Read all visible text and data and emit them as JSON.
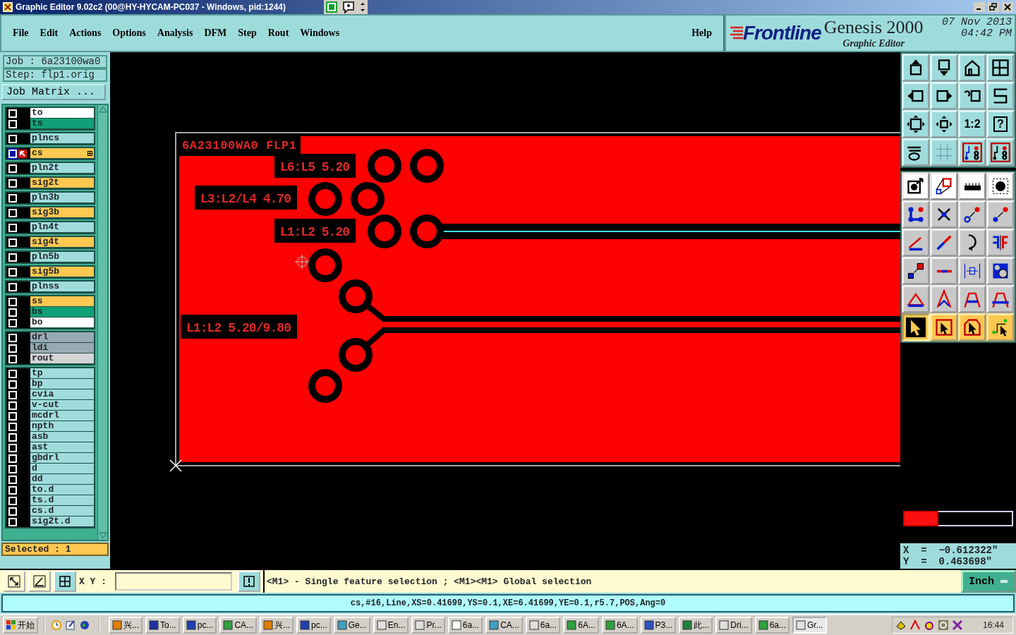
{
  "window": {
    "title": "Graphic Editor 9.02c2 (00@HY-HYCAM-PC037 - Windows, pid:1244)"
  },
  "menu": [
    {
      "label": "File"
    },
    {
      "label": "Edit"
    },
    {
      "label": "Actions"
    },
    {
      "label": "Options"
    },
    {
      "label": "Analysis"
    },
    {
      "label": "DFM"
    },
    {
      "label": "Step"
    },
    {
      "label": "Rout"
    },
    {
      "label": "Windows"
    }
  ],
  "help": "Help",
  "brand": {
    "logo": "Frontline",
    "product": "Genesis 2000",
    "subtitle": "Graphic Editor",
    "date": "07 Nov 2013",
    "time": "04:42 PM"
  },
  "job": {
    "job": "Job  :  6a23100wa0",
    "step": "Step:  flp1.orig",
    "matrix_button": "Job Matrix ..."
  },
  "layer_groups": [
    {
      "layers": [
        {
          "name": "to",
          "color": "#ffffff",
          "selected": false
        },
        {
          "name": "ts",
          "color": "#10a078",
          "selected": false
        }
      ]
    },
    {
      "layers": [
        {
          "name": "plncs",
          "color": "#a0dcdc",
          "selected": false
        }
      ]
    },
    {
      "layers": [
        {
          "name": "cs",
          "color": "#ffc850",
          "selected": true
        }
      ]
    },
    {
      "layers": [
        {
          "name": "pln2t",
          "color": "#a0dcdc",
          "selected": false
        }
      ]
    },
    {
      "layers": [
        {
          "name": "sig2t",
          "color": "#ffc850",
          "selected": false
        }
      ]
    },
    {
      "layers": [
        {
          "name": "pln3b",
          "color": "#a0dcdc",
          "selected": false
        }
      ]
    },
    {
      "layers": [
        {
          "name": "sig3b",
          "color": "#ffc850",
          "selected": false
        }
      ]
    },
    {
      "layers": [
        {
          "name": "pln4t",
          "color": "#a0dcdc",
          "selected": false
        }
      ]
    },
    {
      "layers": [
        {
          "name": "sig4t",
          "color": "#ffc850",
          "selected": false
        }
      ]
    },
    {
      "layers": [
        {
          "name": "pln5b",
          "color": "#a0dcdc",
          "selected": false
        }
      ]
    },
    {
      "layers": [
        {
          "name": "sig5b",
          "color": "#ffc850",
          "selected": false
        }
      ]
    },
    {
      "layers": [
        {
          "name": "plnss",
          "color": "#a0dcdc",
          "selected": false
        }
      ]
    },
    {
      "layers": [
        {
          "name": "ss",
          "color": "#ffc850",
          "selected": false
        },
        {
          "name": "bs",
          "color": "#10a078",
          "selected": false
        },
        {
          "name": "bo",
          "color": "#ffffff",
          "selected": false
        }
      ]
    },
    {
      "layers": [
        {
          "name": "drl",
          "color": "#98aab4",
          "selected": false
        },
        {
          "name": "ldi",
          "color": "#98aab4",
          "selected": false
        },
        {
          "name": "rout",
          "color": "#d4d4d4",
          "selected": false
        }
      ]
    },
    {
      "layers": [
        {
          "name": "tp",
          "color": "#a0dcdc",
          "selected": false
        },
        {
          "name": "bp",
          "color": "#a0dcdc",
          "selected": false
        },
        {
          "name": "cvia",
          "color": "#a0dcdc",
          "selected": false
        },
        {
          "name": "v-cut",
          "color": "#a0dcdc",
          "selected": false
        },
        {
          "name": "mcdrl",
          "color": "#a0dcdc",
          "selected": false
        },
        {
          "name": "npth",
          "color": "#a0dcdc",
          "selected": false
        },
        {
          "name": "asb",
          "color": "#a0dcdc",
          "selected": false
        },
        {
          "name": "ast",
          "color": "#a0dcdc",
          "selected": false
        },
        {
          "name": "gbdrl",
          "color": "#a0dcdc",
          "selected": false
        },
        {
          "name": "d",
          "color": "#a0dcdc",
          "selected": false
        },
        {
          "name": "dd",
          "color": "#a0dcdc",
          "selected": false
        },
        {
          "name": "to.d",
          "color": "#a0dcdc",
          "selected": false
        },
        {
          "name": "ts.d",
          "color": "#a0dcdc",
          "selected": false
        },
        {
          "name": "cs.d",
          "color": "#a0dcdc",
          "selected": false
        },
        {
          "name": "sig2t.d",
          "color": "#a0dcdc",
          "selected": false
        }
      ]
    }
  ],
  "selected_count": "Selected : 1",
  "canvas": {
    "title": "6A23100WA0 FLP1",
    "labels": [
      "L6:L5 5.20",
      "L3:L2/L4 4.70",
      "L1:L2 5.20",
      "L1:L2 5.20/9.80"
    ]
  },
  "toolbar": {
    "ratio": "1:2",
    "help": "?"
  },
  "select_modes": [
    {
      "selected": true
    },
    {
      "selected": false
    },
    {
      "selected": false
    },
    {
      "selected": false
    }
  ],
  "coordinates": {
    "x": "X  =  −0.612322\"",
    "y": "Y  =  0.463698\""
  },
  "command": {
    "xy_label": "X Y :",
    "hint": "<M1> - Single feature selection ; <M1><M1> Global selection",
    "units": "Inch"
  },
  "status": "cs,#16,Line,XS=0.41699,YS=0.1,XE=6.41699,YE=0.1,r5.7,POS,Ang=0",
  "taskbar": {
    "start": "开始",
    "tasks": [
      {
        "label": "兴...",
        "selected": false
      },
      {
        "label": "To...",
        "selected": false
      },
      {
        "label": "pc...",
        "selected": false
      },
      {
        "label": "CA...",
        "selected": false
      },
      {
        "label": "兴...",
        "selected": false
      },
      {
        "label": "pc...",
        "selected": false
      },
      {
        "label": "Ge...",
        "selected": false
      },
      {
        "label": "En...",
        "selected": false
      },
      {
        "label": "Pr...",
        "selected": false
      },
      {
        "label": "6a...",
        "selected": false
      },
      {
        "label": "CA...",
        "selected": false
      },
      {
        "label": "6a...",
        "selected": false
      },
      {
        "label": "6A...",
        "selected": false
      },
      {
        "label": "6A...",
        "selected": false
      },
      {
        "label": "P3...",
        "selected": false
      },
      {
        "label": "此...",
        "selected": false
      },
      {
        "label": "Dri...",
        "selected": false
      },
      {
        "label": "6a...",
        "selected": false
      },
      {
        "label": "Gr...",
        "selected": true
      }
    ],
    "clock": "16:44"
  }
}
